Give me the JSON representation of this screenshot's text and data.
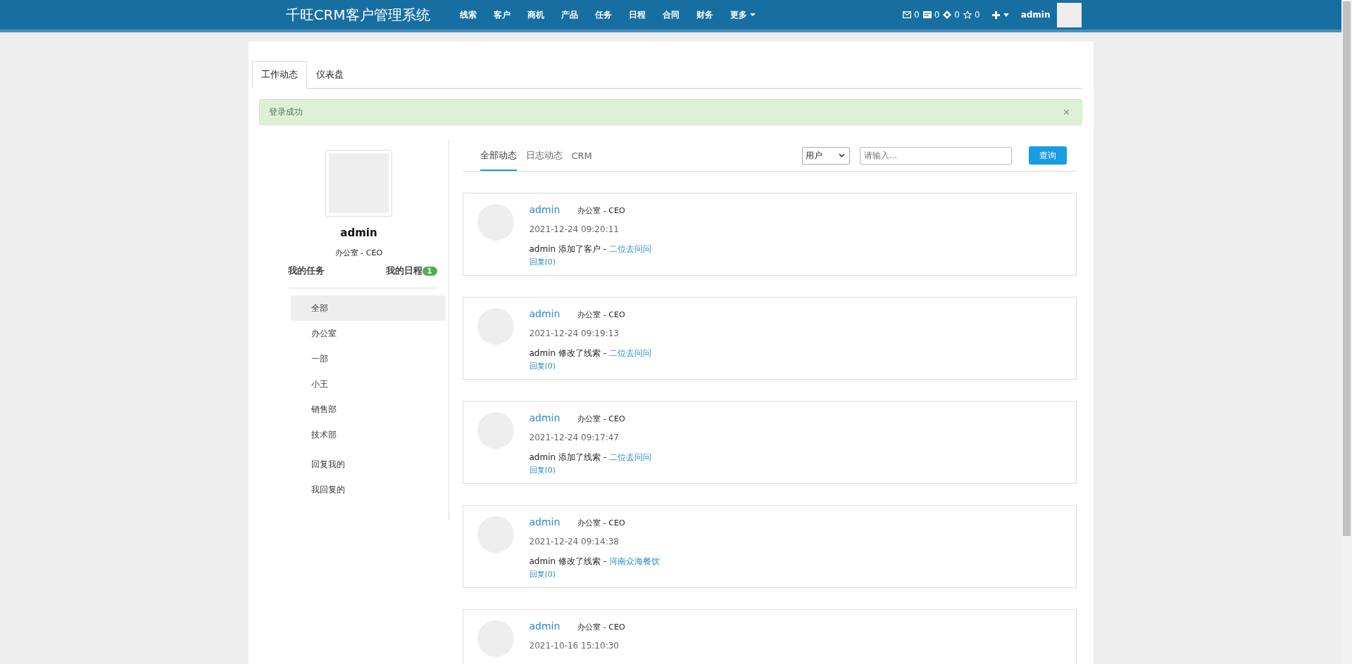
{
  "navbar": {
    "brand": "千旺CRM客户管理系统",
    "menu": [
      {
        "label": "线索",
        "dropdown": false
      },
      {
        "label": "客户",
        "dropdown": false
      },
      {
        "label": "商机",
        "dropdown": false
      },
      {
        "label": "产品",
        "dropdown": false
      },
      {
        "label": "任务",
        "dropdown": false
      },
      {
        "label": "日程",
        "dropdown": false
      },
      {
        "label": "合同",
        "dropdown": false
      },
      {
        "label": "财务",
        "dropdown": false
      },
      {
        "label": "更多",
        "dropdown": true
      }
    ],
    "counters": [
      {
        "kind": "mail",
        "count": "0"
      },
      {
        "kind": "card",
        "count": "0"
      },
      {
        "kind": "diamond",
        "count": "0"
      },
      {
        "kind": "star",
        "count": "0"
      }
    ],
    "user": "admin"
  },
  "tabs": [
    {
      "label": "工作动态",
      "selected": true
    },
    {
      "label": "仪表盘",
      "selected": false
    }
  ],
  "alert": {
    "message": "登录成功",
    "close": "×"
  },
  "profile": {
    "name": "admin",
    "dept": "办公室 - CEO",
    "links": [
      {
        "label": "我的任务"
      },
      {
        "label": "我的日程",
        "badge": "1"
      }
    ]
  },
  "filters": [
    {
      "label": "全部",
      "selected": true
    },
    {
      "label": "办公室",
      "selected": false
    },
    {
      "label": "一部",
      "selected": false
    },
    {
      "label": "小王",
      "selected": false
    },
    {
      "label": "销售部",
      "selected": false
    },
    {
      "label": "技术部",
      "selected": false
    }
  ],
  "reply_filters": [
    {
      "label": "回复我的",
      "selected": false
    },
    {
      "label": "我回复的",
      "selected": false
    }
  ],
  "feed_tabs": [
    {
      "label": "全部动态",
      "selected": true
    },
    {
      "label": "日志动态",
      "selected": false
    },
    {
      "label": "CRM",
      "selected": false
    }
  ],
  "search": {
    "select": "用户",
    "placeholder": "请输入...",
    "button": "查询"
  },
  "posts": [
    {
      "name": "admin",
      "dept": "办公室 - CEO",
      "time": "2021-12-24 09:20:11",
      "action": "admin 添加了客户 - ",
      "target": "二位去问问",
      "reply": "回复(0)"
    },
    {
      "name": "admin",
      "dept": "办公室 - CEO",
      "time": "2021-12-24 09:19:13",
      "action": "admin 修改了线索 - ",
      "target": "二位去问问",
      "reply": "回复(0)"
    },
    {
      "name": "admin",
      "dept": "办公室 - CEO",
      "time": "2021-12-24 09:17:47",
      "action": "admin 添加了线索 - ",
      "target": "二位去问问",
      "reply": "回复(0)"
    },
    {
      "name": "admin",
      "dept": "办公室 - CEO",
      "time": "2021-12-24 09:14:38",
      "action": "admin 修改了线索 - ",
      "target": "河南众海餐饮",
      "reply": "回复(0)"
    },
    {
      "name": "admin",
      "dept": "办公室 - CEO",
      "time": "2021-10-16 15:10:30"
    }
  ]
}
